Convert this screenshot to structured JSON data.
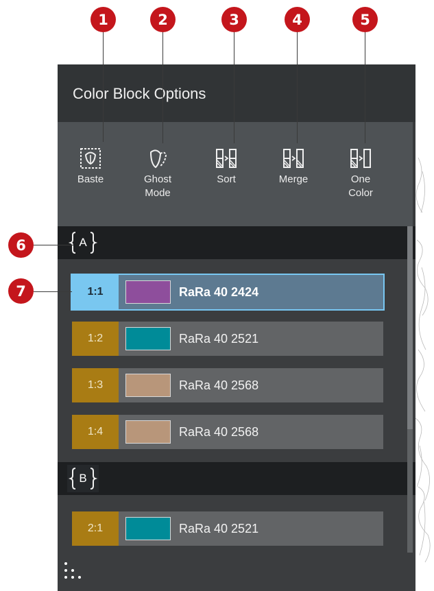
{
  "panel": {
    "title": "Color Block Options"
  },
  "toolbar": {
    "items": [
      {
        "label": "Baste",
        "icon": "baste-icon"
      },
      {
        "label": "Ghost\nMode",
        "icon": "ghost-mode-icon"
      },
      {
        "label": "Sort",
        "icon": "sort-icon"
      },
      {
        "label": "Merge",
        "icon": "merge-icon"
      },
      {
        "label": "One\nColor",
        "icon": "one-color-icon"
      }
    ]
  },
  "callouts": [
    "1",
    "2",
    "3",
    "4",
    "5",
    "6",
    "7"
  ],
  "groups": [
    {
      "letter": "A",
      "rows": [
        {
          "num": "1:1",
          "color": "#8e4e9c",
          "name": "RaRa 40 2424",
          "selected": true
        },
        {
          "num": "1:2",
          "color": "#008b98",
          "name": "RaRa 40 2521",
          "selected": false
        },
        {
          "num": "1:3",
          "color": "#b8967a",
          "name": "RaRa 40 2568",
          "selected": false
        },
        {
          "num": "1:4",
          "color": "#b8967a",
          "name": "RaRa 40 2568",
          "selected": false
        }
      ]
    },
    {
      "letter": "B",
      "rows": [
        {
          "num": "2:1",
          "color": "#008b98",
          "name": "RaRa 40 2521",
          "selected": false
        }
      ]
    }
  ],
  "colors": {
    "callout": "#c4161c",
    "selected_accent": "#79c7f0",
    "number_block": "#a97c14"
  }
}
